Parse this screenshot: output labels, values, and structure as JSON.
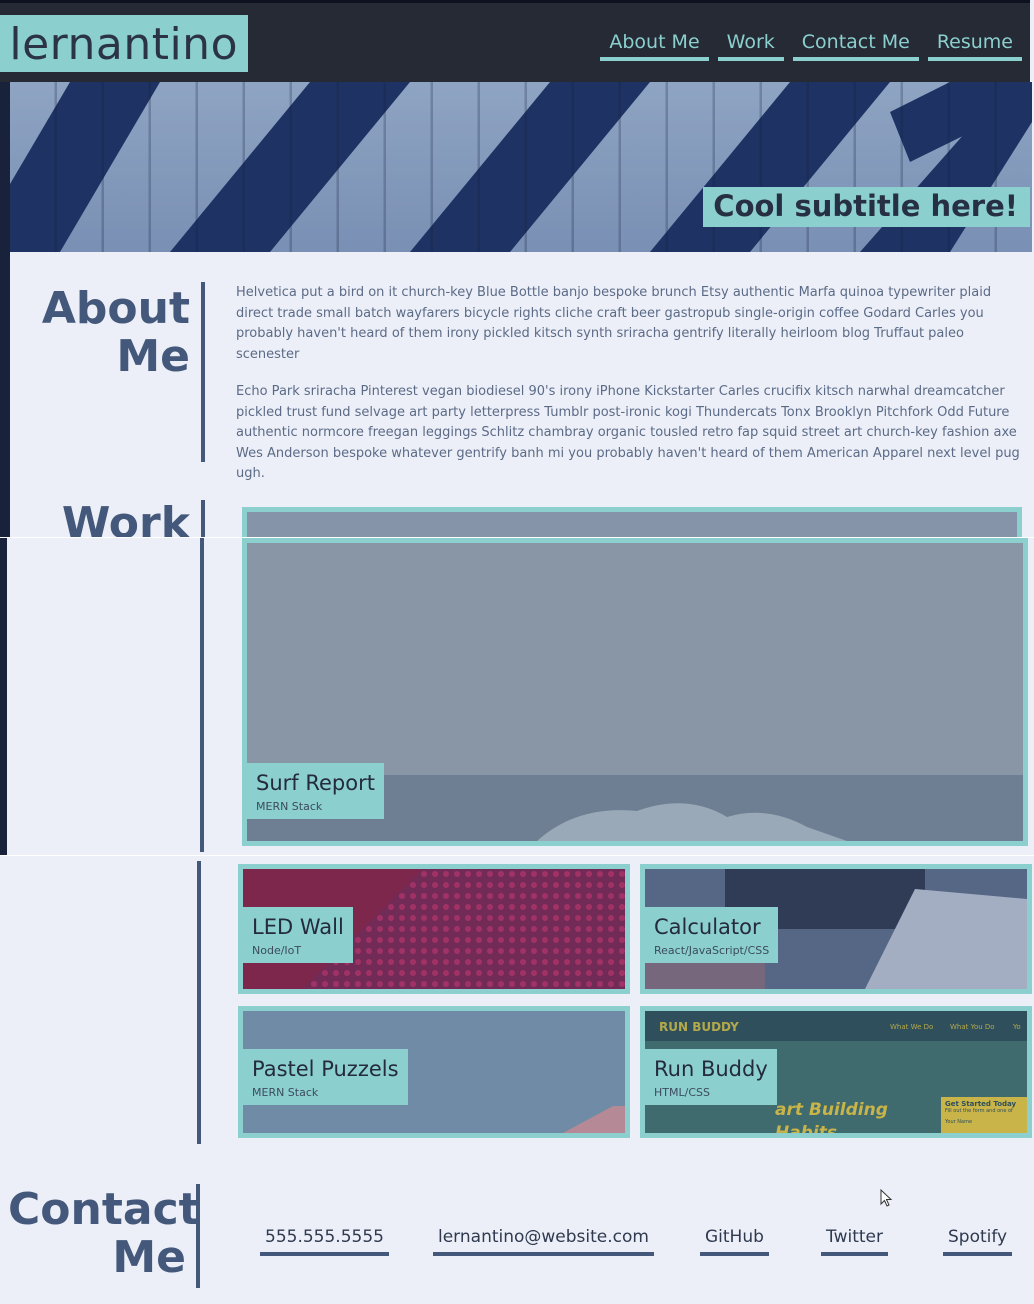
{
  "header": {
    "logo": "lernantino",
    "nav": [
      "About Me",
      "Work",
      "Contact Me",
      "Resume"
    ]
  },
  "hero": {
    "subtitle": "Cool subtitle here!"
  },
  "about": {
    "title_line1": "About",
    "title_line2": "Me",
    "paragraphs": [
      "Helvetica put a bird on it church-key Blue Bottle banjo bespoke brunch Etsy authentic Marfa quinoa typewriter plaid direct trade small batch wayfarers bicycle rights cliche craft beer gastropub single-origin coffee Godard Carles you probably haven't heard of them irony pickled kitsch synth sriracha gentrify literally heirloom blog Truffaut paleo scenester",
      "Echo Park sriracha Pinterest vegan biodiesel 90's irony iPhone Kickstarter Carles crucifix kitsch narwhal dreamcatcher pickled trust fund selvage art party letterpress Tumblr post-ironic kogi Thundercats Tonx Brooklyn Pitchfork Odd Future authentic normcore freegan leggings Schlitz chambray organic tousled retro fap squid street art church-key fashion axe Wes Anderson bespoke whatever gentrify banh mi you probably haven't heard of them American Apparel next level pug ugh."
    ]
  },
  "work": {
    "title": "Work",
    "featured": {
      "title": "Surf Report",
      "stack": "MERN Stack"
    },
    "projects": [
      {
        "title": "LED Wall",
        "stack": "Node/IoT"
      },
      {
        "title": "Calculator",
        "stack": "React/JavaScript/CSS"
      },
      {
        "title": "Pastel Puzzels",
        "stack": "MERN Stack"
      },
      {
        "title": "Run Buddy",
        "stack": "HTML/CSS"
      }
    ],
    "run_buddy_shot": {
      "brand": "RUN BUDDY",
      "nav": [
        "What We Do",
        "What You Do",
        "Yo"
      ],
      "headline": "art Building Habits",
      "cta": "Get Started Today",
      "cta_sub": "Fill out the form and one of",
      "field": "Your Name"
    }
  },
  "contact": {
    "title_line1": "Contact",
    "title_line2": "Me",
    "links": [
      "555.555.5555",
      "lernantino@website.com",
      "GitHub",
      "Twitter",
      "Spotify"
    ]
  },
  "colors": {
    "accent": "#8ccfcf",
    "dark": "#252a35",
    "title": "#43587a",
    "page": "#eceff7"
  },
  "icons": {
    "cursor": "mouse-pointer-icon"
  }
}
